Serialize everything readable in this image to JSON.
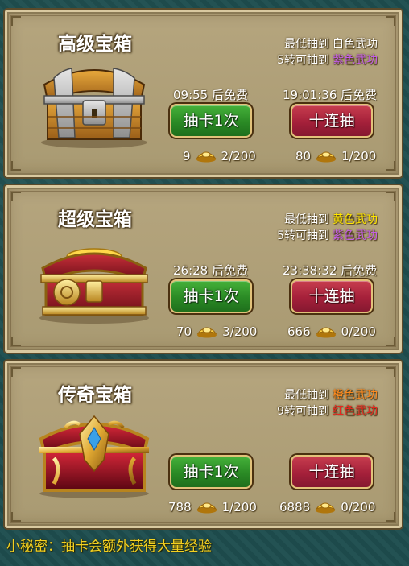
{
  "chests": [
    {
      "name": "高级宝箱",
      "min_label": "最低抽到",
      "min_value": "白色武功",
      "min_color": "#ffffff",
      "rebirth_label": "5转可抽到",
      "rebirth_value": "紫色武功",
      "rebirth_color": "#c45ee8",
      "single_timer": "09:55 后免费",
      "ten_timer": "19:01:36 后免费",
      "single_label": "抽卡1次",
      "ten_label": "十连抽",
      "single_cost": "9",
      "single_count": "2/200",
      "ten_cost": "80",
      "ten_count": "1/200"
    },
    {
      "name": "超级宝箱",
      "min_label": "最低抽到",
      "min_value": "黄色武功",
      "min_color": "#ffe600",
      "rebirth_label": "5转可抽到",
      "rebirth_value": "紫色武功",
      "rebirth_color": "#c45ee8",
      "single_timer": "26:28 后免费",
      "ten_timer": "23:38:32 后免费",
      "single_label": "抽卡1次",
      "ten_label": "十连抽",
      "single_cost": "70",
      "single_count": "3/200",
      "ten_cost": "666",
      "ten_count": "0/200"
    },
    {
      "name": "传奇宝箱",
      "min_label": "最低抽到",
      "min_value": "橙色武功",
      "min_color": "#ff8a1e",
      "rebirth_label": "9转可抽到",
      "rebirth_value": "红色武功",
      "rebirth_color": "#e8261e",
      "single_timer": "",
      "ten_timer": "",
      "single_label": "抽卡1次",
      "ten_label": "十连抽",
      "single_cost": "788",
      "single_count": "1/200",
      "ten_cost": "6888",
      "ten_count": "0/200"
    }
  ],
  "tip": "小秘密：抽卡会额外获得大量经验",
  "icons": {
    "chest": "treasure-chest-icon",
    "currency": "gold-ingot-icon"
  }
}
